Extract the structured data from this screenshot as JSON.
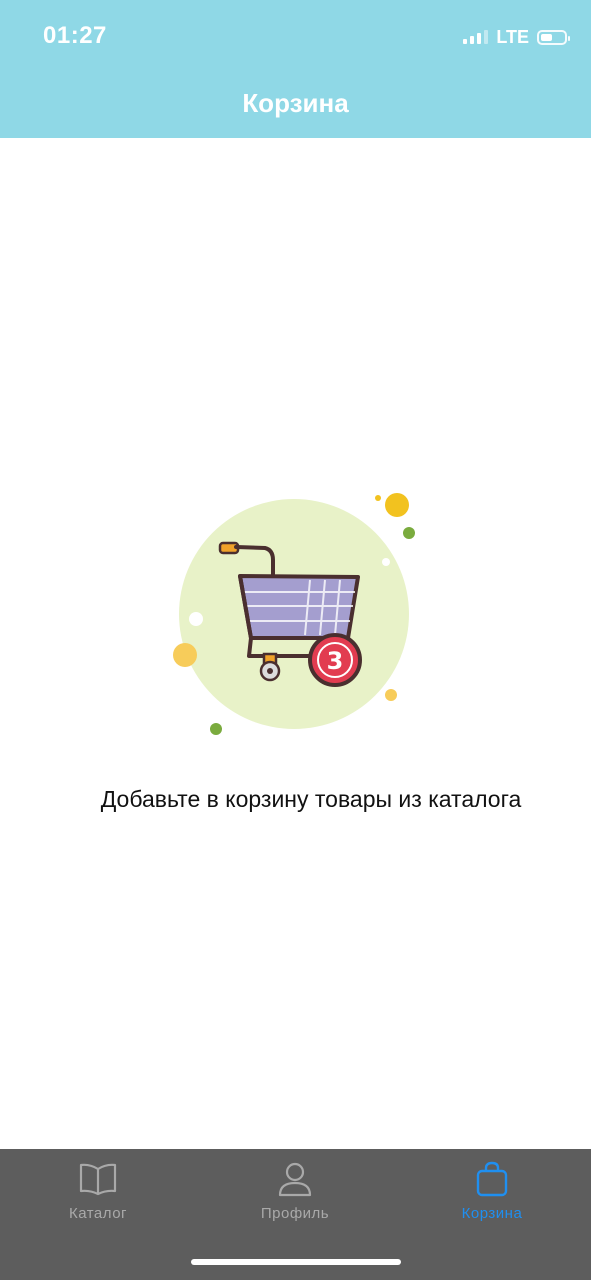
{
  "status_bar": {
    "time": "01:27",
    "network": "LTE",
    "signal_icon": "signal-bars-icon",
    "battery_icon": "battery-icon",
    "battery_level": 0.5
  },
  "header": {
    "title": "Корзина",
    "background": "#8fd8e6"
  },
  "empty_state": {
    "illustration_icon": "shopping-cart-icon",
    "cart_badge": "3",
    "message": "Добавьте в корзину товары из каталога"
  },
  "tabbar": {
    "tabs": [
      {
        "label": "Каталог",
        "icon": "book-icon",
        "active": false
      },
      {
        "label": "Профиль",
        "icon": "person-icon",
        "active": false
      },
      {
        "label": "Корзина",
        "icon": "bag-icon",
        "active": true
      }
    ],
    "active_color": "#1f8ff0",
    "inactive_color": "#a9a9a9",
    "background": "#5d5d5d"
  }
}
